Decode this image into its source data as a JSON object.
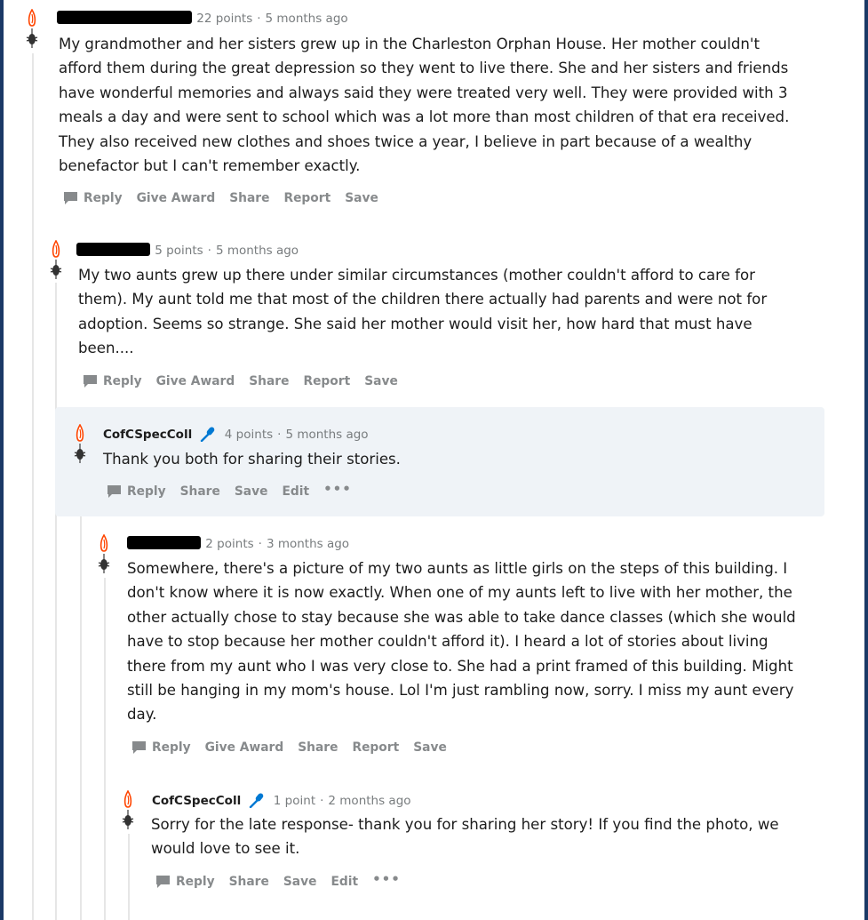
{
  "accent_color": "#ff4500",
  "action_labels": {
    "reply": "Reply",
    "give_award": "Give Award",
    "share": "Share",
    "report": "Report",
    "save": "Save",
    "edit": "Edit",
    "more": "•••"
  },
  "comments": [
    {
      "username": "",
      "username_redacted": true,
      "points": "22 points",
      "time": "5 months ago",
      "lines": [
        "My grandmother and her sisters grew up in the Charleston Orphan House. Her mother couldn't",
        "afford them during the great depression so they went to live there. She and her sisters and friends",
        "have wonderful memories and always said they were treated very well. They were provided with 3",
        "meals a day and were sent to school which was a lot more than most children of that era received.",
        "They also received new clothes and shoes twice a year, I believe in part because of a wealthy",
        "benefactor but I can't remember exactly."
      ]
    },
    {
      "username": "",
      "username_redacted": true,
      "points": "5 points",
      "time": "5 months ago",
      "lines": [
        "My two aunts grew up there under similar circumstances (mother couldn't afford to care for",
        "them). My aunt told me that most of the children there actually had parents and were not for",
        "adoption. Seems so strange. She said her mother would visit her, how hard that must have",
        "been...."
      ]
    },
    {
      "username": "CofCSpecColl",
      "username_redacted": false,
      "points": "4 points",
      "time": "5 months ago",
      "icon": "microphone-icon",
      "lines": [
        "Thank you both for sharing their stories."
      ]
    },
    {
      "username": "",
      "username_redacted": true,
      "points": "2 points",
      "time": "3 months ago",
      "lines": [
        "Somewhere, there's a picture of my two aunts as little girls on the steps of this building. I",
        "don't know where it is now exactly. When one of my aunts left to live with her mother, the",
        "other actually chose to stay because she was able to take dance classes (which she would",
        "have to stop because her mother couldn't afford it). I heard a lot of stories about living",
        "there from my aunt who I was very close to. She had a print framed of this building. Might",
        "still be hanging in my mom's house. Lol I'm just rambling now, sorry. I miss my aunt every",
        "day."
      ]
    },
    {
      "username": "CofCSpecColl",
      "username_redacted": false,
      "points": "1 point",
      "time": "2 months ago",
      "icon": "microphone-icon",
      "lines": [
        "Sorry for the late response- thank you for sharing her story! If you find the photo, we",
        "would love to see it."
      ]
    }
  ]
}
